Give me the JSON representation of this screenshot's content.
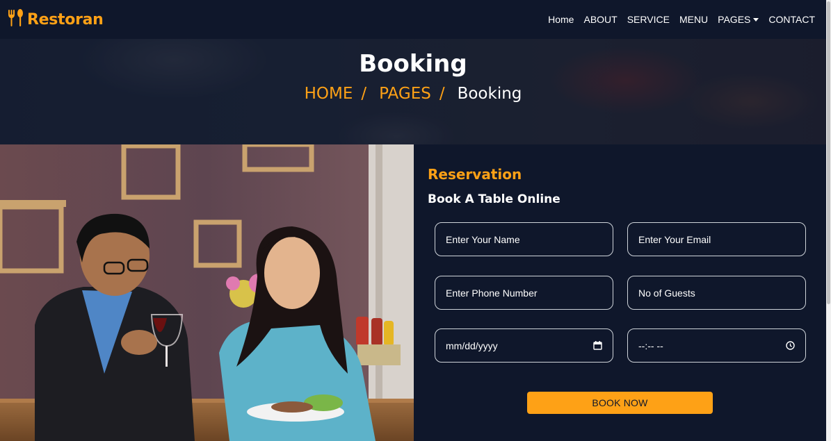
{
  "brand": {
    "name": "Restoran",
    "icon": "utensils-icon",
    "color": "#fea116"
  },
  "nav": {
    "items": [
      {
        "label": "Home"
      },
      {
        "label": "ABOUT"
      },
      {
        "label": "SERVICE"
      },
      {
        "label": "MENU"
      },
      {
        "label": "PAGES"
      },
      {
        "label": "CONTACT"
      }
    ]
  },
  "hero": {
    "title": "Booking",
    "breadcrumb": {
      "home": "HOME",
      "sep1": "/",
      "pages": "PAGES",
      "sep2": "/",
      "current": "Booking"
    }
  },
  "reservation": {
    "label": "Reservation",
    "heading": "Book A Table Online",
    "fields": {
      "name_placeholder": "Enter Your Name",
      "email_placeholder": "Enter Your Email",
      "phone_placeholder": "Enter Phone Number",
      "guests_placeholder": "No of Guests",
      "date_placeholder": "mm/dd/yyyy",
      "time_placeholder": "--:-- --"
    },
    "submit_label": "BOOK NOW"
  },
  "colors": {
    "accent": "#fea116",
    "dark": "#0f172b"
  }
}
